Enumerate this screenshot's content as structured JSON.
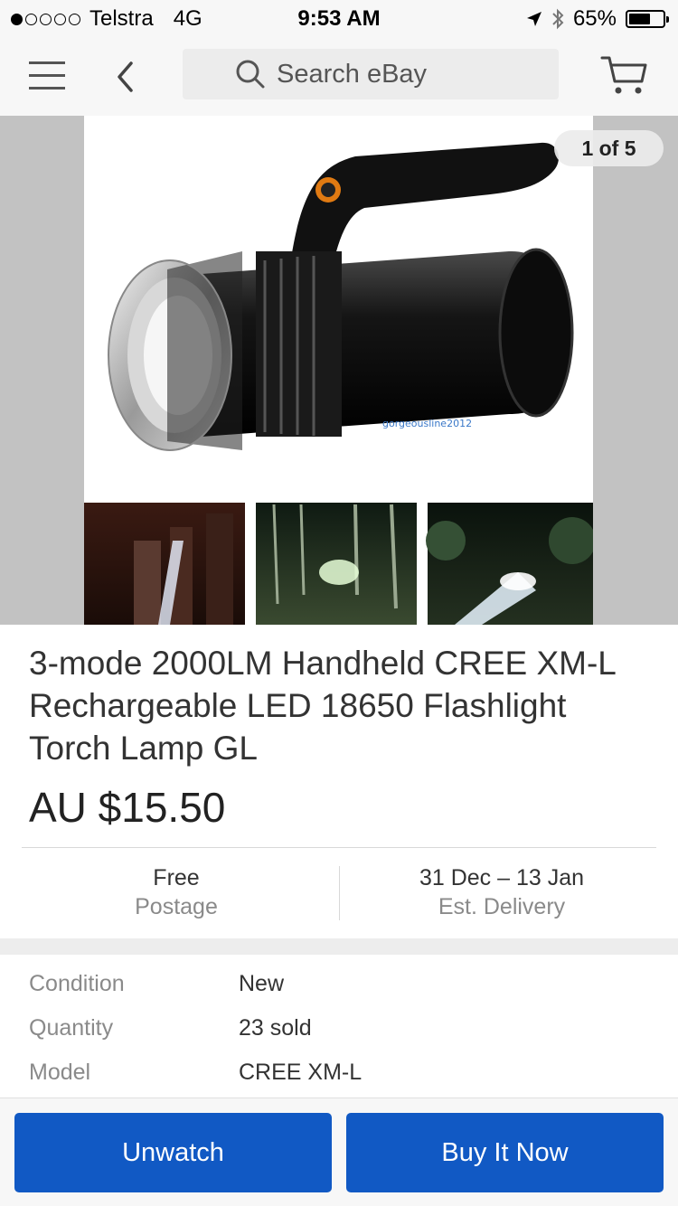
{
  "status_bar": {
    "carrier": "Telstra",
    "network": "4G",
    "time": "9:53 AM",
    "battery": "65%",
    "battery_level": 0.65,
    "signal_bars_filled": 1,
    "signal_bars_total": 5,
    "icons": [
      "location-arrow-icon",
      "bluetooth-icon",
      "battery-icon"
    ]
  },
  "nav": {
    "search_placeholder": "Search eBay",
    "icons": [
      "hamburger-menu-icon",
      "back-chevron-icon",
      "search-icon",
      "cart-icon"
    ]
  },
  "gallery": {
    "counter": "1 of 5",
    "watermark": "gorgeousline2012"
  },
  "listing": {
    "title": "3-mode 2000LM Handheld CREE XM-L Rechargeable LED 18650 Flashlight Torch Lamp GL",
    "price": "AU $15.50"
  },
  "shipping": {
    "postage_primary": "Free",
    "postage_secondary": "Postage",
    "delivery_primary": "31 Dec – 13 Jan",
    "delivery_secondary": "Est. Delivery"
  },
  "specs": [
    {
      "label": "Condition",
      "value": "New"
    },
    {
      "label": "Quantity",
      "value": "23 sold"
    },
    {
      "label": "Model",
      "value": "CREE XM-L"
    }
  ],
  "actions": {
    "unwatch": "Unwatch",
    "buy_now": "Buy It Now"
  },
  "colors": {
    "primary_button": "#1159c4",
    "bar_background": "#f7f7f7",
    "secondary_text": "#8a8a8a"
  }
}
